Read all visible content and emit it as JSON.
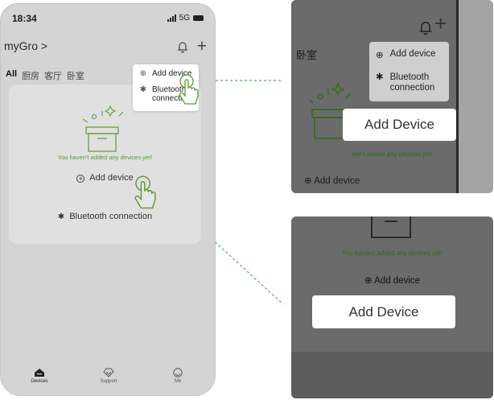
{
  "colors": {
    "accent_green": "#5a9a2e",
    "connector_green": "#2e9a2e",
    "phone_bg": "#d4d4d4",
    "panel_dark": "#6b6b6b"
  },
  "phone": {
    "status": {
      "time": "18:34",
      "network": "5G"
    },
    "header": {
      "title": "myGro >",
      "bell_icon": "bell-icon",
      "plus_icon": "plus-icon"
    },
    "rooms": [
      "All",
      "厨房",
      "客厅",
      "卧室"
    ],
    "popup": {
      "add_device": "Add device",
      "bluetooth_line1": "Bluetooth",
      "bluetooth_line2": "connection"
    },
    "empty_state": {
      "message": "You haven't added any devices yet!",
      "add_device": "Add device",
      "bluetooth": "Bluetooth connection"
    },
    "tabs": [
      {
        "label": "Devices",
        "icon": "home-icon",
        "active": true
      },
      {
        "label": "Support",
        "icon": "support-icon",
        "active": false
      },
      {
        "label": "Me",
        "icon": "smiley-icon",
        "active": false
      }
    ]
  },
  "zoom_top": {
    "room": "卧室",
    "popup_add": "Add device",
    "popup_bt_line1": "Bluetooth",
    "popup_bt_line2": "connection",
    "empty_message": "ven't added any devices yet!",
    "add_device": "Add device",
    "caption": "Add Device"
  },
  "zoom_bottom": {
    "empty_message": "You haven't added any devices yet!",
    "add_device": "Add device",
    "caption": "Add Device"
  }
}
